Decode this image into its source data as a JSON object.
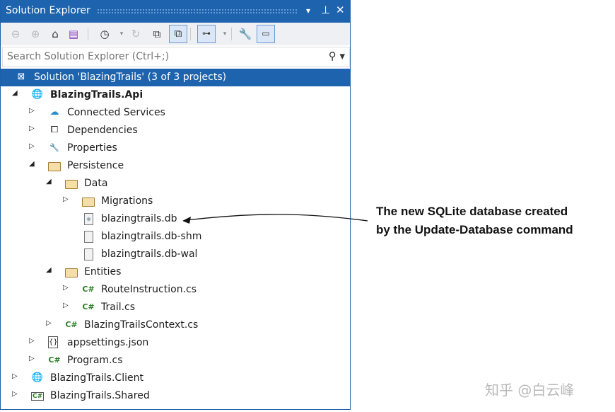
{
  "panel": {
    "title": "Solution Explorer",
    "dropdown_icon": "▾",
    "pin_icon": "⊥",
    "close_icon": "✕"
  },
  "search": {
    "placeholder": "Search Solution Explorer (Ctrl+;)"
  },
  "tree": [
    {
      "label": "Solution 'BlazingTrails' (3 of 3 projects)",
      "icon": "solution",
      "selected": true
    },
    {
      "label": "BlazingTrails.Api",
      "icon": "web-project",
      "bold": true,
      "expanded": true
    },
    {
      "label": "Connected Services",
      "icon": "cloud"
    },
    {
      "label": "Dependencies",
      "icon": "dependencies"
    },
    {
      "label": "Properties",
      "icon": "properties"
    },
    {
      "label": "Persistence",
      "icon": "folder-open",
      "expanded": true
    },
    {
      "label": "Data",
      "icon": "folder-open",
      "expanded": true
    },
    {
      "label": "Migrations",
      "icon": "folder"
    },
    {
      "label": "blazingtrails.db",
      "icon": "db-file"
    },
    {
      "label": "blazingtrails.db-shm",
      "icon": "file"
    },
    {
      "label": "blazingtrails.db-wal",
      "icon": "file"
    },
    {
      "label": "Entities",
      "icon": "folder-open",
      "expanded": true
    },
    {
      "label": "RouteInstruction.cs",
      "icon": "csharp"
    },
    {
      "label": "Trail.cs",
      "icon": "csharp"
    },
    {
      "label": "BlazingTrailsContext.cs",
      "icon": "csharp"
    },
    {
      "label": "appsettings.json",
      "icon": "json"
    },
    {
      "label": "Program.cs",
      "icon": "csharp"
    },
    {
      "label": "BlazingTrails.Client",
      "icon": "web-project"
    },
    {
      "label": "BlazingTrails.Shared",
      "icon": "csharp-project"
    }
  ],
  "annotation": {
    "line1": "The new SQLite database created",
    "line2": "by the Update-Database command"
  },
  "watermark": "知乎 @白云峰"
}
